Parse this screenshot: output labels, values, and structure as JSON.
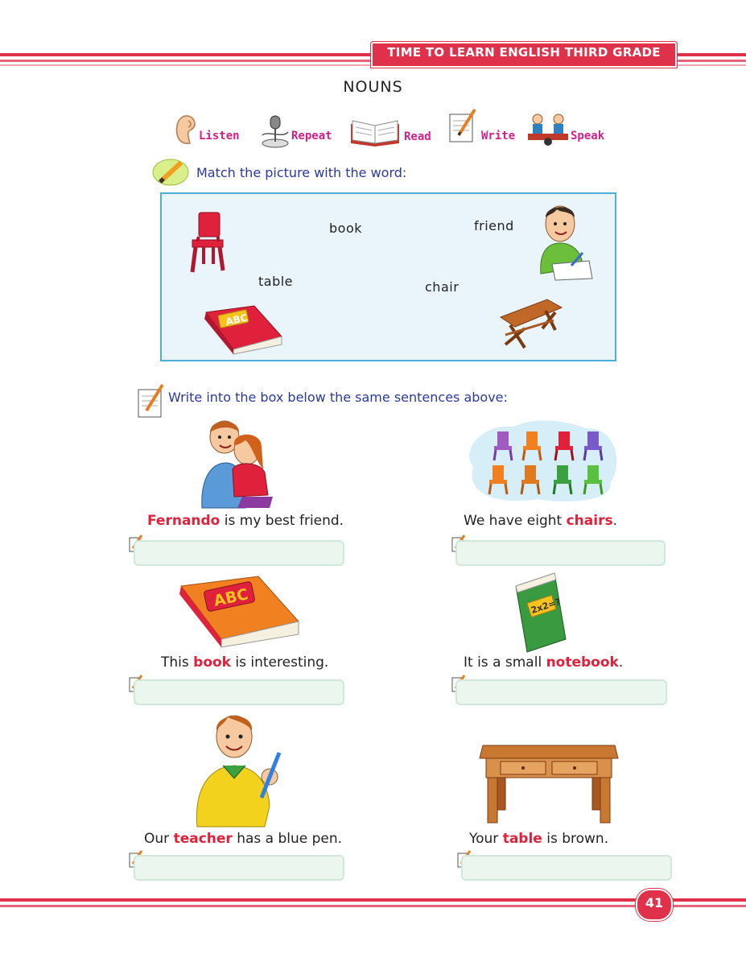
{
  "header": {
    "book_title": "TIME TO LEARN ENGLISH THIRD GRADE"
  },
  "page_title": "NOUNS",
  "skills": [
    {
      "label": "Listen",
      "icon": "ear-icon"
    },
    {
      "label": "Repeat",
      "icon": "microphone-icon"
    },
    {
      "label": "Read",
      "icon": "open-book-icon"
    },
    {
      "label": "Write",
      "icon": "notepad-pencil-icon"
    },
    {
      "label": "Speak",
      "icon": "children-talking-icon"
    }
  ],
  "exercise1": {
    "instruction": "Match the picture with the word:",
    "words": [
      "book",
      "friend",
      "table",
      "chair"
    ]
  },
  "exercise2": {
    "instruction": "Write into the box below the same sentences above:",
    "sentences": [
      {
        "before": "",
        "noun": "Fernando",
        "after": " is my best friend."
      },
      {
        "before": "We have eight ",
        "noun": "chairs",
        "after": "."
      },
      {
        "before": "This ",
        "noun": "book",
        "after": " is interesting."
      },
      {
        "before": "It is a small ",
        "noun": "notebook",
        "after": "."
      },
      {
        "before": "Our ",
        "noun": "teacher",
        "after": " has a blue pen."
      },
      {
        "before": "Your ",
        "noun": "table",
        "after": " is brown."
      }
    ]
  },
  "footer": {
    "page_number": "41"
  },
  "colors": {
    "accent": "#e0314a",
    "instruction_blue": "#2a3a9a",
    "skill_pink": "#d0208a",
    "highlight_red": "#e0213b"
  }
}
